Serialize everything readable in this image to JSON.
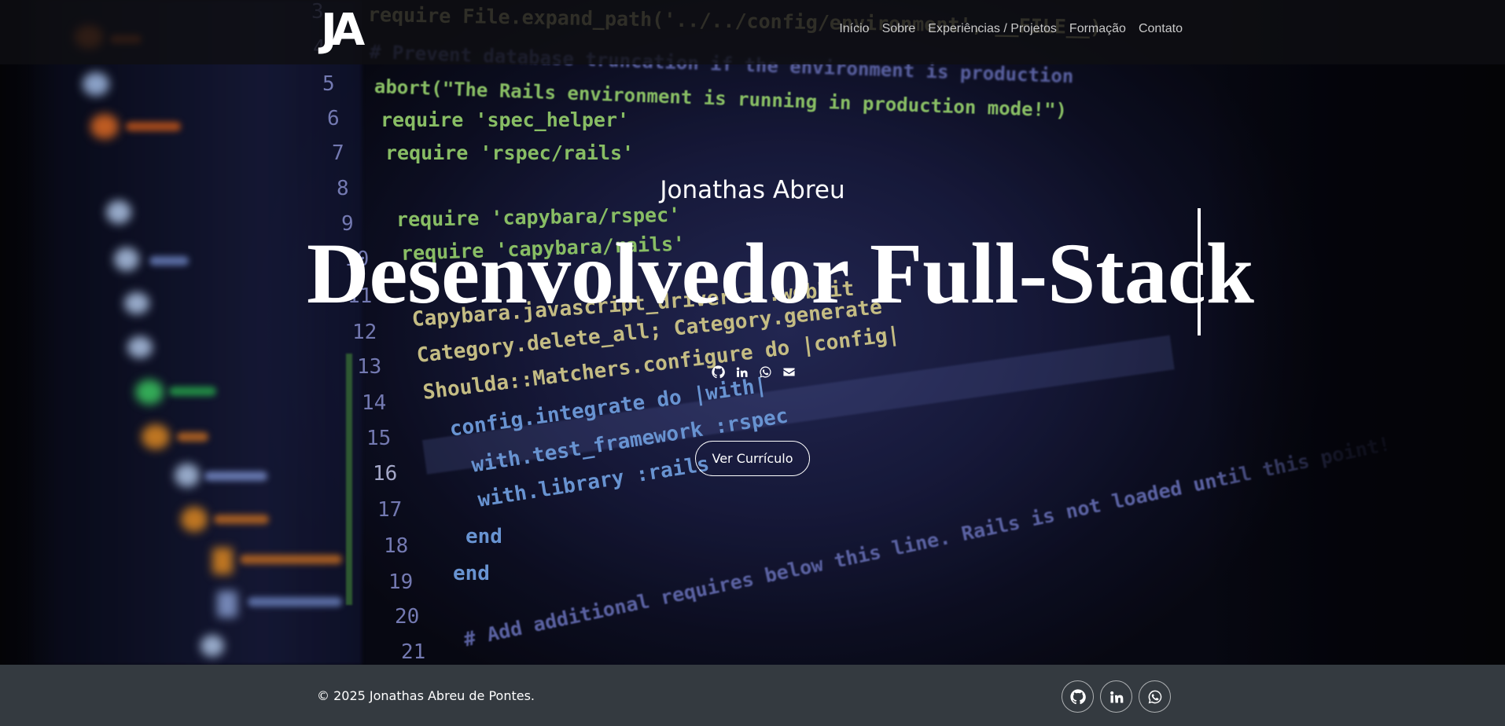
{
  "nav": {
    "logo_text": "JA",
    "links": [
      {
        "label": "Início"
      },
      {
        "label": "Sobre"
      },
      {
        "label": "Experiências / Projetos"
      },
      {
        "label": "Formação"
      },
      {
        "label": "Contato"
      }
    ]
  },
  "hero": {
    "name": "Jonathas Abreu",
    "title": "Desenvolvedor Full-Stack",
    "social_icons": [
      "github-icon",
      "linkedin-icon",
      "whatsapp-icon",
      "envelope-icon"
    ],
    "cv_button_label": "Ver Currículo"
  },
  "background_code": {
    "line_numbers": [
      "3",
      "4",
      "5",
      "6",
      "7",
      "8",
      "9",
      "10",
      "11",
      "12",
      "13",
      "14",
      "15",
      "16",
      "17",
      "18",
      "19",
      "20",
      "21"
    ],
    "lines": [
      "require File.expand_path('../../config/environment', __FILE__)",
      "# Prevent database truncation if the environment is production",
      "abort(\"The Rails environment is running in production mode!\")",
      "require 'spec_helper'",
      "require 'rspec/rails'",
      "require 'capybara/rspec'",
      "require 'capybara/rails'",
      "Capybara.javascript_driver = :webkit",
      "Category.delete_all; Category.generate",
      "Shoulda::Matchers.configure do |config|",
      "config.integrate do |with|",
      "with.test_framework :rspec",
      "with.library :rails",
      "end",
      "end",
      "# Add additional requires below this line. Rails is not loaded until this point!"
    ]
  },
  "footer": {
    "copyright": "© 2025 Jonathas Abreu de Pontes.",
    "social_icons": [
      "github-icon",
      "linkedin-icon",
      "whatsapp-icon"
    ]
  },
  "colors": {
    "navbar_bg": "#0f0f12",
    "footer_bg": "#343a40",
    "nav_link": "#c9c9c9",
    "text": "#ffffff"
  }
}
